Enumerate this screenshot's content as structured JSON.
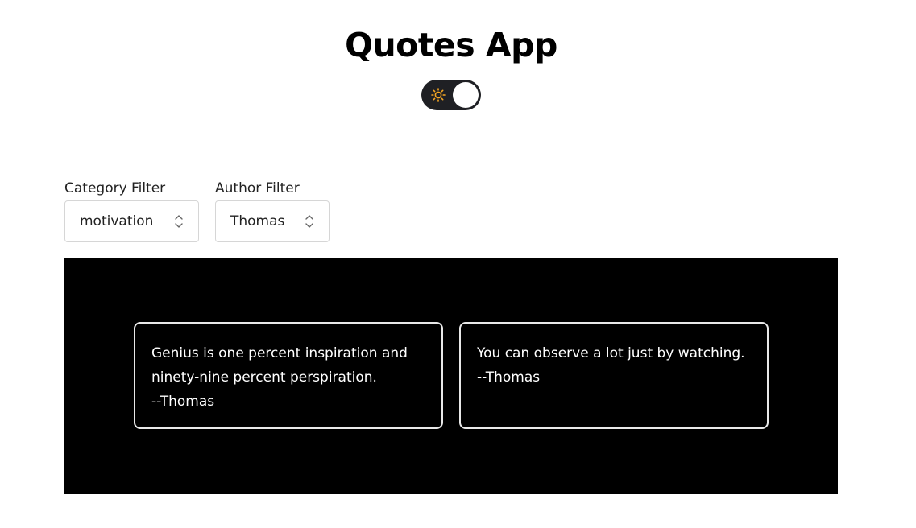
{
  "app": {
    "title": "Quotes App"
  },
  "theme_toggle": {
    "icon": "sun-icon",
    "state": "light",
    "track_color": "#1f2024",
    "icon_color": "#f5a623"
  },
  "filters": {
    "category": {
      "label": "Category Filter",
      "selected": "motivation"
    },
    "author": {
      "label": "Author Filter",
      "selected": "Thomas"
    }
  },
  "quotes": [
    {
      "text": "Genius is one percent inspiration and ninety-nine percent perspiration.",
      "author": "--Thomas"
    },
    {
      "text": "You can observe a lot just by watching.",
      "author": "--Thomas"
    }
  ],
  "colors": {
    "panel_background": "#000000",
    "card_border": "#e8e8e8",
    "card_text": "#ffffff"
  }
}
